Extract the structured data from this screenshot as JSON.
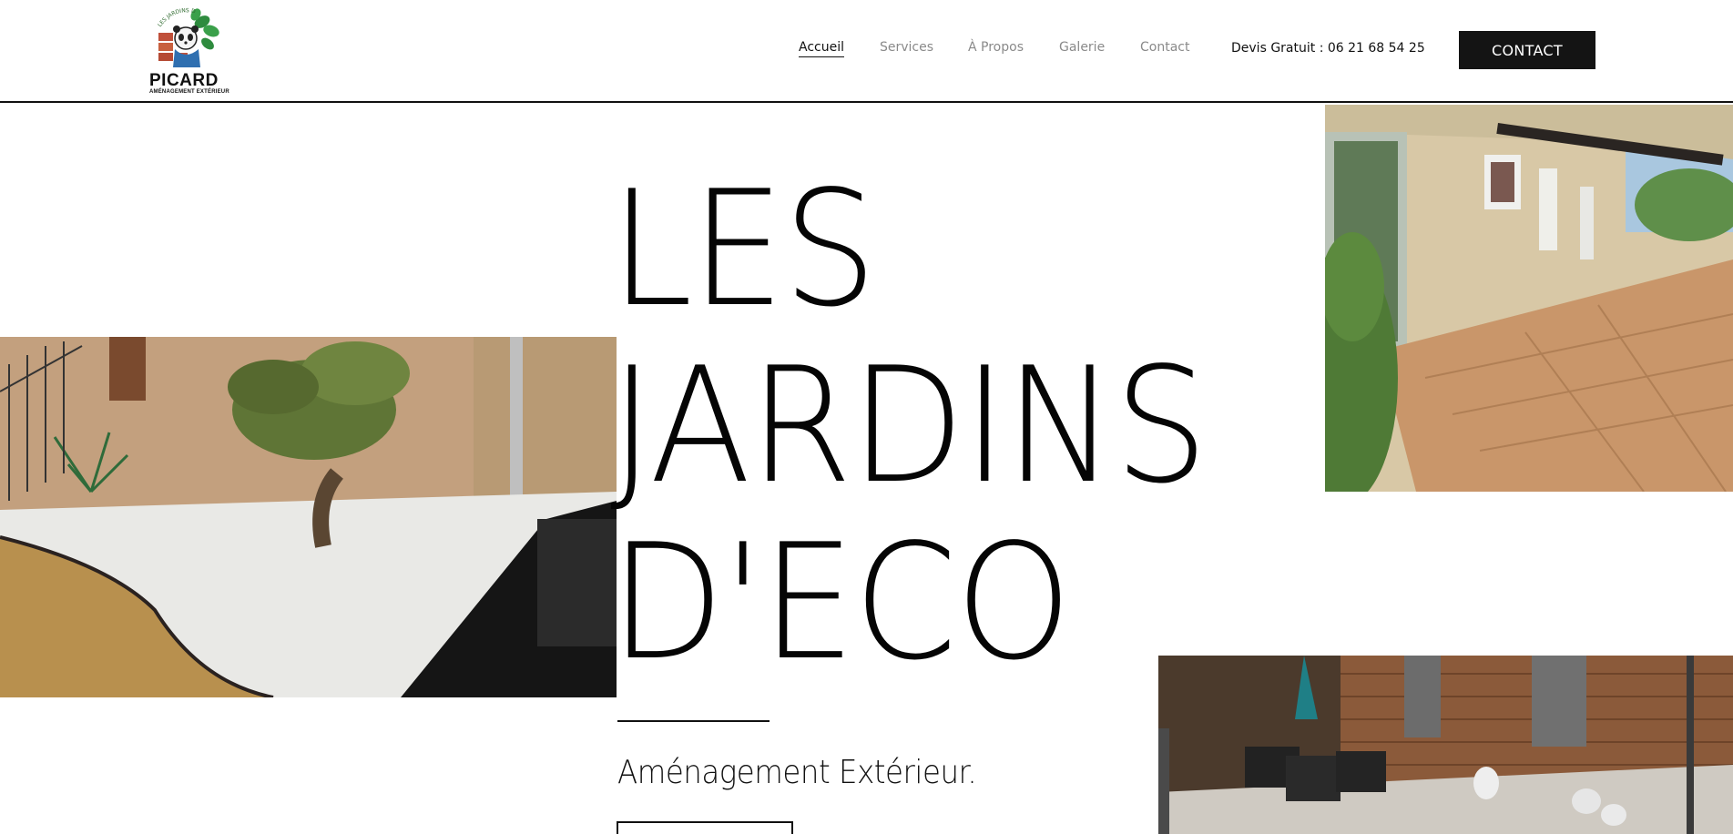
{
  "brand": {
    "logo_icon": "panda-garden-logo-icon",
    "name": "PICARD",
    "tagline": "AMÉNAGEMENT EXTÉRIEUR",
    "arc_text": "LES JARDINS D'ECO"
  },
  "nav": {
    "items": [
      {
        "label": "Accueil",
        "active": true
      },
      {
        "label": "Services",
        "active": false
      },
      {
        "label": "À Propos",
        "active": false
      },
      {
        "label": "Galerie",
        "active": false
      },
      {
        "label": "Contact",
        "active": false
      }
    ],
    "devis": "Devis Gratuit : 06 21 68 54 25",
    "contact_button": "CONTACT"
  },
  "hero": {
    "title": "LES\nJARDINS\nD'ECO",
    "subtitle": "Aménagement Extérieur.",
    "photos": [
      "garden-white-pebbles-olive-tree-photo",
      "stone-house-tiled-terrace-photo",
      "wooden-facade-patio-furniture-photo"
    ]
  },
  "colors": {
    "text": "#111111",
    "button_bg": "#141414",
    "nav_inactive": "#8a8a8a",
    "background": "#ffffff"
  }
}
